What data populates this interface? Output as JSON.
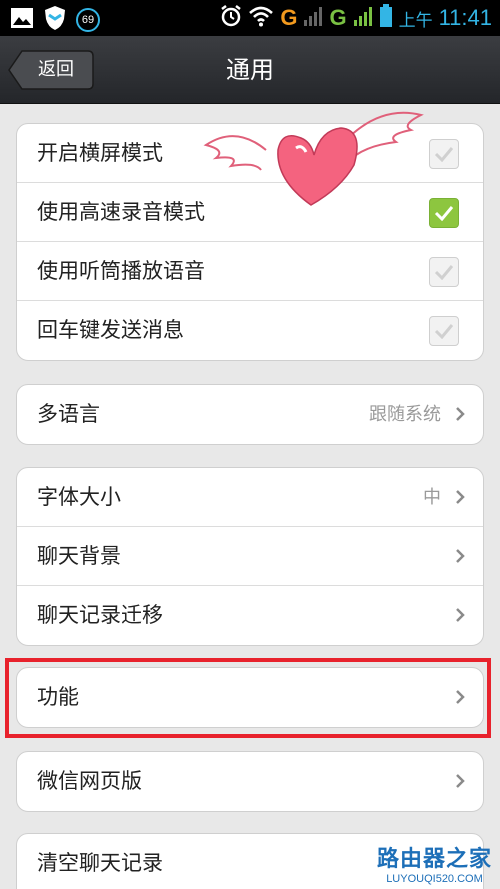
{
  "status_bar": {
    "notification_badge": "69",
    "network_g1": "G",
    "network_g2": "G",
    "ampm": "上午",
    "time": "11:41",
    "icons": [
      "image-icon",
      "shield-icon",
      "alarm-icon",
      "wifi-icon",
      "signal-icon",
      "battery-icon"
    ]
  },
  "title_bar": {
    "back_label": "返回",
    "title": "通用"
  },
  "toggles": [
    {
      "label": "开启横屏模式",
      "checked": false
    },
    {
      "label": "使用高速录音模式",
      "checked": true
    },
    {
      "label": "使用听筒播放语音",
      "checked": false
    },
    {
      "label": "回车键发送消息",
      "checked": false
    }
  ],
  "language": {
    "label": "多语言",
    "value": "跟随系统"
  },
  "chat_settings": [
    {
      "label": "字体大小",
      "value": "中"
    },
    {
      "label": "聊天背景",
      "value": ""
    },
    {
      "label": "聊天记录迁移",
      "value": ""
    }
  ],
  "features": {
    "label": "功能"
  },
  "web_version": {
    "label": "微信网页版"
  },
  "clear_history": {
    "label": "清空聊天记录"
  },
  "watermark": {
    "brand": "路由器之家",
    "url": "LUYOUQI520.COM"
  },
  "colors": {
    "accent_blue": "#33b5e5",
    "check_green": "#8dc63f",
    "highlight_red": "#e8222c",
    "title_bar": "#2e3034"
  }
}
